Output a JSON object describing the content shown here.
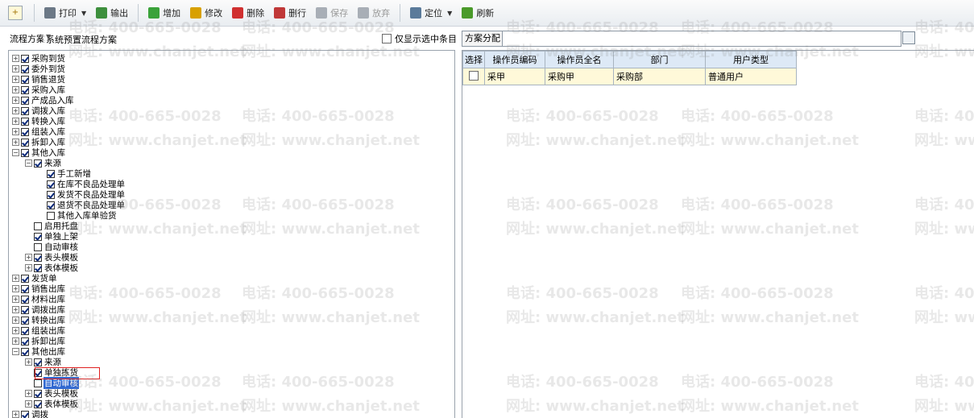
{
  "toolbar": {
    "buttons": [
      {
        "label": "打印",
        "icon": "printer-icon",
        "dropdown": true,
        "enabled": true
      },
      {
        "label": "输出",
        "icon": "export-icon",
        "enabled": true
      },
      {
        "label": "增加",
        "icon": "add-icon",
        "enabled": true
      },
      {
        "label": "修改",
        "icon": "pencil-icon",
        "enabled": true
      },
      {
        "label": "删除",
        "icon": "delete-icon",
        "enabled": true
      },
      {
        "label": "删行",
        "icon": "delete-row-icon",
        "enabled": true
      },
      {
        "label": "保存",
        "icon": "save-icon",
        "enabled": false
      },
      {
        "label": "放弃",
        "icon": "discard-icon",
        "enabled": false
      },
      {
        "label": "定位",
        "icon": "locate-icon",
        "dropdown": true,
        "enabled": true
      },
      {
        "label": "刷新",
        "icon": "refresh-icon",
        "enabled": true
      }
    ]
  },
  "scheme": {
    "label": "流程方案",
    "value": "系统预置流程方案",
    "only_selected_label": "仅显示选中条目"
  },
  "assign": {
    "button_label": "方案分配",
    "input_value": ""
  },
  "tree": [
    {
      "label": "采购到货",
      "checked": true,
      "expander": "+",
      "level": 0
    },
    {
      "label": "委外到货",
      "checked": true,
      "expander": "+",
      "level": 0
    },
    {
      "label": "销售退货",
      "checked": true,
      "expander": "+",
      "level": 0
    },
    {
      "label": "采购入库",
      "checked": true,
      "expander": "+",
      "level": 0
    },
    {
      "label": "产成品入库",
      "checked": true,
      "expander": "+",
      "level": 0
    },
    {
      "label": "调拨入库",
      "checked": true,
      "expander": "+",
      "level": 0
    },
    {
      "label": "转换入库",
      "checked": true,
      "expander": "+",
      "level": 0
    },
    {
      "label": "组装入库",
      "checked": true,
      "expander": "+",
      "level": 0
    },
    {
      "label": "拆卸入库",
      "checked": true,
      "expander": "+",
      "level": 0
    },
    {
      "label": "其他入库",
      "checked": true,
      "expander": "-",
      "level": 0
    },
    {
      "label": "来源",
      "checked": true,
      "expander": "-",
      "level": 1
    },
    {
      "label": "手工新增",
      "checked": true,
      "expander": "",
      "level": 2
    },
    {
      "label": "在库不良品处理单",
      "checked": true,
      "expander": "",
      "level": 2
    },
    {
      "label": "发货不良品处理单",
      "checked": true,
      "expander": "",
      "level": 2
    },
    {
      "label": "退货不良品处理单",
      "checked": true,
      "expander": "",
      "level": 2
    },
    {
      "label": "其他入库单验货",
      "checked": false,
      "expander": "",
      "level": 2
    },
    {
      "label": "启用托盘",
      "checked": false,
      "expander": "",
      "level": 1
    },
    {
      "label": "单独上架",
      "checked": true,
      "expander": "",
      "level": 1
    },
    {
      "label": "自动审核",
      "checked": false,
      "expander": "",
      "level": 1
    },
    {
      "label": "表头模板",
      "checked": true,
      "expander": "+",
      "level": 1
    },
    {
      "label": "表体模板",
      "checked": true,
      "expander": "+",
      "level": 1
    },
    {
      "label": "发货单",
      "checked": true,
      "expander": "+",
      "level": 0
    },
    {
      "label": "销售出库",
      "checked": true,
      "expander": "+",
      "level": 0
    },
    {
      "label": "材料出库",
      "checked": true,
      "expander": "+",
      "level": 0
    },
    {
      "label": "调拨出库",
      "checked": true,
      "expander": "+",
      "level": 0
    },
    {
      "label": "转换出库",
      "checked": true,
      "expander": "+",
      "level": 0
    },
    {
      "label": "组装出库",
      "checked": true,
      "expander": "+",
      "level": 0
    },
    {
      "label": "拆卸出库",
      "checked": true,
      "expander": "+",
      "level": 0
    },
    {
      "label": "其他出库",
      "checked": true,
      "expander": "-",
      "level": 0
    },
    {
      "label": "来源",
      "checked": true,
      "expander": "+",
      "level": 1
    },
    {
      "label": "单独拣货",
      "checked": true,
      "expander": "",
      "level": 1,
      "boxed": true
    },
    {
      "label": "自动审核",
      "checked": false,
      "expander": "",
      "level": 1,
      "selected": true
    },
    {
      "label": "表头模板",
      "checked": true,
      "expander": "+",
      "level": 1
    },
    {
      "label": "表体模板",
      "checked": true,
      "expander": "+",
      "level": 1
    },
    {
      "label": "调拨",
      "checked": true,
      "expander": "+",
      "level": 0
    }
  ],
  "grid": {
    "headers": [
      "选择",
      "操作员编码",
      "操作员全名",
      "部门",
      "用户类型"
    ],
    "rows": [
      {
        "selected": false,
        "code": "采甲",
        "name": "采购甲",
        "dept": "采购部",
        "type": "普通用户"
      }
    ]
  },
  "watermark": {
    "phone": "电话: 400-665-0028",
    "site": "网址: www.chanjet.net"
  }
}
